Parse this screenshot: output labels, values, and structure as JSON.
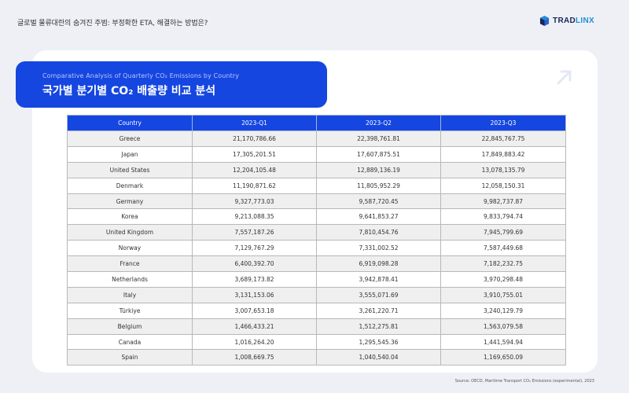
{
  "page": {
    "top_title": "글로벌 물류대란의 숨겨진 주범: 부정확한 ETA, 해결하는 방법은?",
    "logo_text_a": "TRAD",
    "logo_text_b": "LINX",
    "source": "Source: OECD, Maritime Transport CO₂ Emissions (experimental), 2023"
  },
  "banner": {
    "subtitle": "Comparative Analysis of Quarterly CO₂ Emissions by Country",
    "title": "국가별 분기별 CO₂ 배출량 비교 분석"
  },
  "colors": {
    "accent": "#1546e0",
    "background": "#eef0f6"
  },
  "table": {
    "headers": [
      "Country",
      "2023-Q1",
      "2023-Q2",
      "2023-Q3"
    ],
    "rows": [
      [
        "Greece",
        "21,170,786.66",
        "22,398,761.81",
        "22,845,767.75"
      ],
      [
        "Japan",
        "17,305,201.51",
        "17,607,875.51",
        "17,849,883.42"
      ],
      [
        "United States",
        "12,204,105.48",
        "12,889,136.19",
        "13,078,135.79"
      ],
      [
        "Denmark",
        "11,190,871.62",
        "11,805,952.29",
        "12,058,150.31"
      ],
      [
        "Germany",
        "9,327,773.03",
        "9,587,720.45",
        "9,982,737.87"
      ],
      [
        "Korea",
        "9,213,088.35",
        "9,641,853.27",
        "9,833,794.74"
      ],
      [
        "United Kingdom",
        "7,557,187.26",
        "7,810,454.76",
        "7,945,799.69"
      ],
      [
        "Norway",
        "7,129,767.29",
        "7,331,002.52",
        "7,587,449.68"
      ],
      [
        "France",
        "6,400,392.70",
        "6,919,098.28",
        "7,182,232.75"
      ],
      [
        "Netherlands",
        "3,689,173.82",
        "3,942,878.41",
        "3,970,298.48"
      ],
      [
        "Italy",
        "3,131,153.06",
        "3,555,071.69",
        "3,910,755.01"
      ],
      [
        "Türkiye",
        "3,007,653.18",
        "3,261,220.71",
        "3,240,129.79"
      ],
      [
        "Belgium",
        "1,466,433.21",
        "1,512,275.81",
        "1,563,079.58"
      ],
      [
        "Canada",
        "1,016,264.20",
        "1,295,545.36",
        "1,441,594.94"
      ],
      [
        "Spain",
        "1,008,669.75",
        "1,040,540.04",
        "1,169,650.09"
      ]
    ]
  }
}
